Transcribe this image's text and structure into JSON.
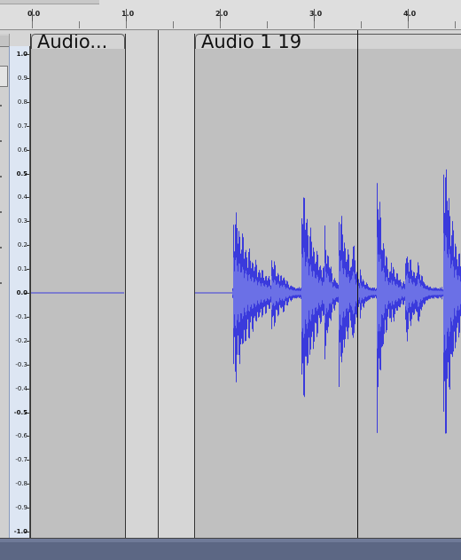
{
  "timeline_ruler": {
    "labels": [
      "0.0",
      "1.0",
      "2.0",
      "3.0",
      "4.0"
    ]
  },
  "amplitude_scale": {
    "labels": [
      "1.0",
      "0.9",
      "0.8",
      "0.7",
      "0.6",
      "0.5",
      "0.4",
      "0.3",
      "0.2",
      "0.1",
      "0.0",
      "-0.1",
      "-0.2",
      "-0.3",
      "-0.4",
      "-0.5",
      "-0.6",
      "-0.7",
      "-0.8",
      "-0.9",
      "-1.0"
    ]
  },
  "clips": [
    {
      "name": "Audio...",
      "start_sec": 0.0,
      "end_sec": 1.0
    },
    {
      "name": "Audio 1 19",
      "start_sec": 1.72,
      "end_sec": 4.6
    }
  ],
  "cursor_sec": 3.48,
  "colors": {
    "waveform": "#3a3adc",
    "waveform_rms": "#6b70e6",
    "clip_background": "#c0c0c0",
    "bottom_bar": "#5c6784"
  },
  "icons": {
    "track_menu": "chevron-down-icon"
  }
}
